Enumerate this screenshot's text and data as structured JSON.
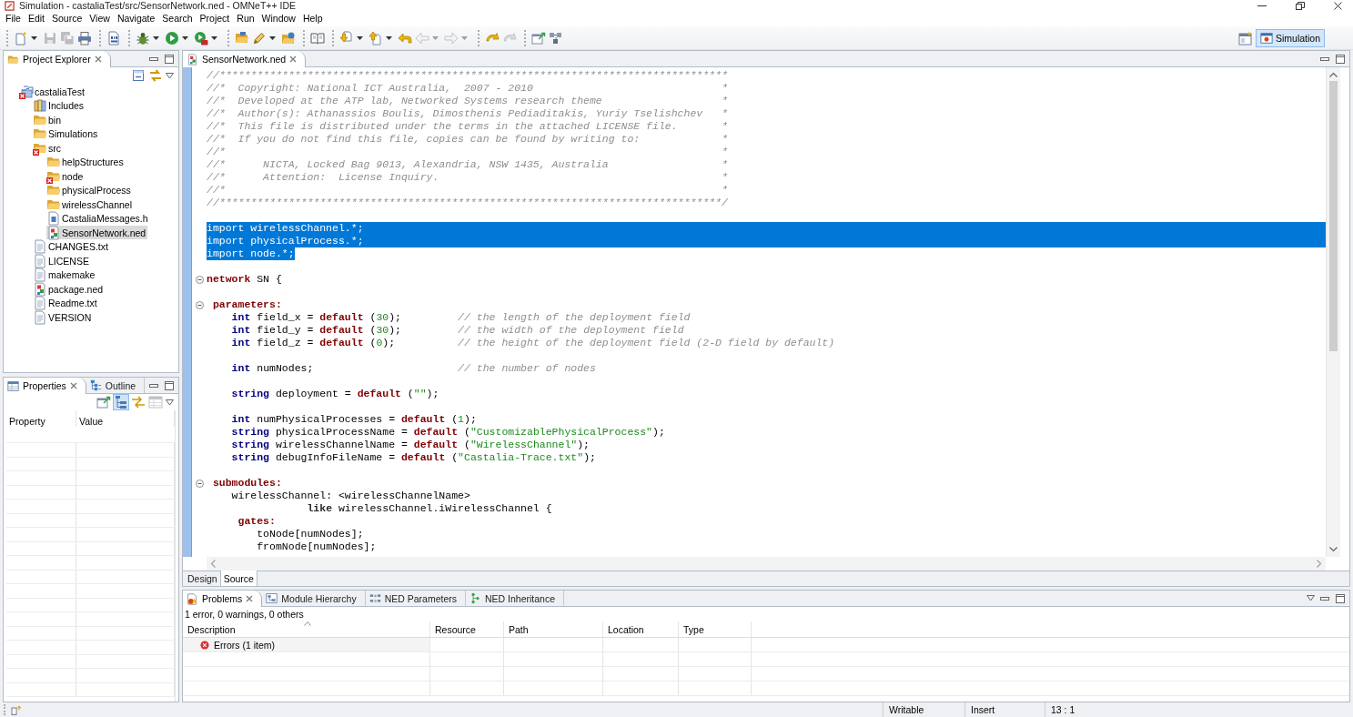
{
  "window": {
    "title": "Simulation - castaliaTest/src/SensorNetwork.ned - OMNeT++ IDE"
  },
  "menu_bar": [
    "File",
    "Edit",
    "Source",
    "View",
    "Navigate",
    "Search",
    "Project",
    "Run",
    "Window",
    "Help"
  ],
  "toolbar": {
    "groups": [
      {
        "items": [
          {
            "disabled": false,
            "dropdown": true
          },
          {
            "disabled": true,
            "dropdown": false
          },
          {
            "disabled": true,
            "dropdown": false
          },
          {
            "disabled": false,
            "dropdown": false
          }
        ]
      },
      {
        "items": [
          {
            "disabled": false,
            "dropdown": false
          }
        ]
      },
      {
        "items": [
          {
            "disabled": false,
            "dropdown": true
          },
          {
            "disabled": false,
            "dropdown": true
          },
          {
            "disabled": false,
            "dropdown": true
          }
        ]
      },
      {
        "items": [
          {
            "disabled": false,
            "dropdown": false
          },
          {
            "disabled": false,
            "dropdown": true
          },
          {
            "disabled": false,
            "dropdown": false
          }
        ]
      },
      {
        "items": [
          {
            "disabled": false,
            "dropdown": false
          }
        ]
      },
      {
        "items": [
          {
            "disabled": false,
            "dropdown": true
          },
          {
            "disabled": false,
            "dropdown": true
          },
          {
            "disabled": false,
            "dropdown": false
          },
          {
            "disabled": true,
            "dropdown": true
          },
          {
            "disabled": true,
            "dropdown": true
          }
        ]
      },
      {
        "items": [
          {
            "disabled": false,
            "dropdown": false
          },
          {
            "disabled": true,
            "dropdown": false
          }
        ]
      },
      {
        "items": [
          {
            "disabled": false,
            "dropdown": false
          },
          {
            "disabled": false,
            "dropdown": false
          }
        ]
      }
    ]
  },
  "perspectives": [
    {
      "label": "Simulation",
      "selected": true
    }
  ],
  "project_explorer": {
    "tabs": [
      {
        "label": "Project Explorer",
        "selected": true
      }
    ],
    "tree": [
      {
        "label": "castaliaTest",
        "kind": "project",
        "error": true,
        "selected": false,
        "children": [
          {
            "label": "Includes",
            "kind": "includes",
            "error": false,
            "selected": false
          },
          {
            "label": "bin",
            "kind": "folder",
            "error": false,
            "selected": false
          },
          {
            "label": "Simulations",
            "kind": "folder",
            "error": false,
            "selected": false
          },
          {
            "label": "src",
            "kind": "folder",
            "error": true,
            "selected": false,
            "children": [
              {
                "label": "helpStructures",
                "kind": "folder",
                "error": false,
                "selected": false
              },
              {
                "label": "node",
                "kind": "folder",
                "error": true,
                "selected": false
              },
              {
                "label": "physicalProcess",
                "kind": "folder",
                "error": false,
                "selected": false
              },
              {
                "label": "wirelessChannel",
                "kind": "folder",
                "error": false,
                "selected": false
              },
              {
                "label": "CastaliaMessages.h",
                "kind": "header",
                "error": false,
                "selected": false
              },
              {
                "label": "SensorNetwork.ned",
                "kind": "ned",
                "error": false,
                "selected": true
              }
            ]
          },
          {
            "label": "CHANGES.txt",
            "kind": "text",
            "error": false,
            "selected": false
          },
          {
            "label": "LICENSE",
            "kind": "text",
            "error": false,
            "selected": false
          },
          {
            "label": "makemake",
            "kind": "text",
            "error": false,
            "selected": false
          },
          {
            "label": "package.ned",
            "kind": "ned",
            "error": false,
            "selected": false
          },
          {
            "label": "Readme.txt",
            "kind": "text",
            "error": false,
            "selected": false
          },
          {
            "label": "VERSION",
            "kind": "text",
            "error": false,
            "selected": false
          }
        ]
      }
    ]
  },
  "properties_panel": {
    "tabs": [
      {
        "label": "Properties",
        "selected": true
      },
      {
        "label": "Outline",
        "selected": false
      }
    ],
    "toolbar": [
      {
        "selected": false,
        "disabled": false
      },
      {
        "selected": true,
        "disabled": false
      },
      {
        "selected": false,
        "disabled": false
      },
      {
        "selected": false,
        "disabled": true
      }
    ],
    "columns": [
      "Property",
      "Value"
    ]
  },
  "editor": {
    "tabs": [
      {
        "label": "SensorNetwork.ned",
        "selected": true
      }
    ],
    "lines": [
      {
        "kind": "code",
        "selected": false,
        "spans": [
          {
            "kind": "comment",
            "text": "//*********************************************************************************"
          }
        ]
      },
      {
        "kind": "code",
        "selected": false,
        "spans": [
          {
            "kind": "comment",
            "text": "//*  Copyright: National ICT Australia,  2007 - 2010                              *"
          }
        ]
      },
      {
        "kind": "code",
        "selected": false,
        "spans": [
          {
            "kind": "comment",
            "text": "//*  Developed at the ATP lab, Networked Systems research theme                   *"
          }
        ]
      },
      {
        "kind": "code",
        "selected": false,
        "spans": [
          {
            "kind": "comment",
            "text": "//*  Author(s): Athanassios Boulis, Dimosthenis Pediaditakis, Yuriy Tselishchev   *"
          }
        ]
      },
      {
        "kind": "code",
        "selected": false,
        "spans": [
          {
            "kind": "comment",
            "text": "//*  This file is distributed under the terms in the attached LICENSE file.       *"
          }
        ]
      },
      {
        "kind": "code",
        "selected": false,
        "spans": [
          {
            "kind": "comment",
            "text": "//*  If you do not find this file, copies can be found by writing to:             *"
          }
        ]
      },
      {
        "kind": "code",
        "selected": false,
        "spans": [
          {
            "kind": "comment",
            "text": "//*                                                                               *"
          }
        ]
      },
      {
        "kind": "code",
        "selected": false,
        "spans": [
          {
            "kind": "comment",
            "text": "//*      NICTA, Locked Bag 9013, Alexandria, NSW 1435, Australia                  *"
          }
        ]
      },
      {
        "kind": "code",
        "selected": false,
        "spans": [
          {
            "kind": "comment",
            "text": "//*      Attention:  License Inquiry.                                             *"
          }
        ]
      },
      {
        "kind": "code",
        "selected": false,
        "spans": [
          {
            "kind": "comment",
            "text": "//*                                                                               *"
          }
        ]
      },
      {
        "kind": "code",
        "selected": false,
        "spans": [
          {
            "kind": "comment",
            "text": "//********************************************************************************/"
          }
        ]
      },
      {
        "kind": "blank"
      },
      {
        "kind": "code",
        "selected": true,
        "spans": [
          {
            "kind": "plain",
            "text": "import wirelessChannel.*;"
          }
        ]
      },
      {
        "kind": "code",
        "selected": true,
        "spans": [
          {
            "kind": "plain",
            "text": "import physicalProcess.*;"
          }
        ]
      },
      {
        "kind": "code",
        "selected": true,
        "spans": [
          {
            "kind": "plain",
            "text": "import node.*;"
          }
        ]
      },
      {
        "kind": "blank"
      },
      {
        "kind": "code",
        "selected": false,
        "expanded": true,
        "spans": [
          {
            "kind": "keyword",
            "text": "network"
          },
          {
            "kind": "plain",
            "text": " SN {"
          }
        ]
      },
      {
        "kind": "blank"
      },
      {
        "kind": "code",
        "selected": false,
        "expanded": true,
        "spans": [
          {
            "kind": "keyword",
            "text": " parameters:"
          }
        ]
      },
      {
        "kind": "code",
        "selected": false,
        "spans": [
          {
            "kind": "type",
            "text": "    int"
          },
          {
            "kind": "plain",
            "text": " field_x = "
          },
          {
            "kind": "keyword",
            "text": "default"
          },
          {
            "kind": "plain",
            "text": " ("
          },
          {
            "kind": "number",
            "text": "30"
          },
          {
            "kind": "plain",
            "text": ");         "
          },
          {
            "kind": "comment",
            "text": "// the length of the deployment field"
          }
        ]
      },
      {
        "kind": "code",
        "selected": false,
        "spans": [
          {
            "kind": "type",
            "text": "    int"
          },
          {
            "kind": "plain",
            "text": " field_y = "
          },
          {
            "kind": "keyword",
            "text": "default"
          },
          {
            "kind": "plain",
            "text": " ("
          },
          {
            "kind": "number",
            "text": "30"
          },
          {
            "kind": "plain",
            "text": ");         "
          },
          {
            "kind": "comment",
            "text": "// the width of the deployment field"
          }
        ]
      },
      {
        "kind": "code",
        "selected": false,
        "spans": [
          {
            "kind": "type",
            "text": "    int"
          },
          {
            "kind": "plain",
            "text": " field_z = "
          },
          {
            "kind": "keyword",
            "text": "default"
          },
          {
            "kind": "plain",
            "text": " ("
          },
          {
            "kind": "number",
            "text": "0"
          },
          {
            "kind": "plain",
            "text": ");          "
          },
          {
            "kind": "comment",
            "text": "// the height of the deployment field (2-D field by default)"
          }
        ]
      },
      {
        "kind": "blank"
      },
      {
        "kind": "code",
        "selected": false,
        "spans": [
          {
            "kind": "type",
            "text": "    int"
          },
          {
            "kind": "plain",
            "text": " numNodes;                       "
          },
          {
            "kind": "comment",
            "text": "// the number of nodes"
          }
        ]
      },
      {
        "kind": "blank"
      },
      {
        "kind": "code",
        "selected": false,
        "spans": [
          {
            "kind": "type",
            "text": "    string"
          },
          {
            "kind": "plain",
            "text": " deployment = "
          },
          {
            "kind": "keyword",
            "text": "default"
          },
          {
            "kind": "plain",
            "text": " ("
          },
          {
            "kind": "string",
            "text": "\"\""
          },
          {
            "kind": "plain",
            "text": ");"
          }
        ]
      },
      {
        "kind": "blank"
      },
      {
        "kind": "code",
        "selected": false,
        "spans": [
          {
            "kind": "type",
            "text": "    int"
          },
          {
            "kind": "plain",
            "text": " numPhysicalProcesses = "
          },
          {
            "kind": "keyword",
            "text": "default"
          },
          {
            "kind": "plain",
            "text": " ("
          },
          {
            "kind": "number",
            "text": "1"
          },
          {
            "kind": "plain",
            "text": ");"
          }
        ]
      },
      {
        "kind": "code",
        "selected": false,
        "spans": [
          {
            "kind": "type",
            "text": "    string"
          },
          {
            "kind": "plain",
            "text": " physicalProcessName = "
          },
          {
            "kind": "keyword",
            "text": "default"
          },
          {
            "kind": "plain",
            "text": " ("
          },
          {
            "kind": "string",
            "text": "\"CustomizablePhysicalProcess\""
          },
          {
            "kind": "plain",
            "text": ");"
          }
        ]
      },
      {
        "kind": "code",
        "selected": false,
        "spans": [
          {
            "kind": "type",
            "text": "    string"
          },
          {
            "kind": "plain",
            "text": " wirelessChannelName = "
          },
          {
            "kind": "keyword",
            "text": "default"
          },
          {
            "kind": "plain",
            "text": " ("
          },
          {
            "kind": "string",
            "text": "\"WirelessChannel\""
          },
          {
            "kind": "plain",
            "text": ");"
          }
        ]
      },
      {
        "kind": "code",
        "selected": false,
        "spans": [
          {
            "kind": "type",
            "text": "    string"
          },
          {
            "kind": "plain",
            "text": " debugInfoFileName = "
          },
          {
            "kind": "keyword",
            "text": "default"
          },
          {
            "kind": "plain",
            "text": " ("
          },
          {
            "kind": "string",
            "text": "\"Castalia-Trace.txt\""
          },
          {
            "kind": "plain",
            "text": ");"
          }
        ]
      },
      {
        "kind": "blank"
      },
      {
        "kind": "code",
        "selected": false,
        "expanded": true,
        "spans": [
          {
            "kind": "keyword",
            "text": " submodules:"
          }
        ]
      },
      {
        "kind": "code",
        "selected": false,
        "spans": [
          {
            "kind": "plain",
            "text": "    wirelessChannel: <wirelessChannelName>"
          }
        ]
      },
      {
        "kind": "code",
        "selected": false,
        "spans": [
          {
            "kind": "reserved",
            "text": "                like"
          },
          {
            "kind": "plain",
            "text": " wirelessChannel.iWirelessChannel {"
          }
        ]
      },
      {
        "kind": "code",
        "selected": false,
        "spans": [
          {
            "kind": "keyword",
            "text": "     gates:"
          }
        ]
      },
      {
        "kind": "code",
        "selected": false,
        "spans": [
          {
            "kind": "plain",
            "text": "        toNode[numNodes];"
          }
        ]
      },
      {
        "kind": "code",
        "selected": false,
        "spans": [
          {
            "kind": "plain",
            "text": "        fromNode[numNodes];"
          }
        ]
      }
    ],
    "mode_tabs": [
      {
        "label": "Design",
        "selected": false
      },
      {
        "label": "Source",
        "selected": true
      }
    ]
  },
  "problems_panel": {
    "tabs": [
      {
        "label": "Problems",
        "selected": true
      },
      {
        "label": "Module Hierarchy",
        "selected": false
      },
      {
        "label": "NED Parameters",
        "selected": false
      },
      {
        "label": "NED Inheritance",
        "selected": false
      }
    ],
    "summary": "1 error, 0 warnings, 0 others",
    "columns": [
      "Description",
      "Resource",
      "Path",
      "Location",
      "Type"
    ],
    "rows": [
      {
        "label": "Errors (1 item)",
        "kind": "error"
      }
    ]
  },
  "status_bar": {
    "items": [
      "Writable",
      "Insert",
      "13 : 1"
    ]
  }
}
